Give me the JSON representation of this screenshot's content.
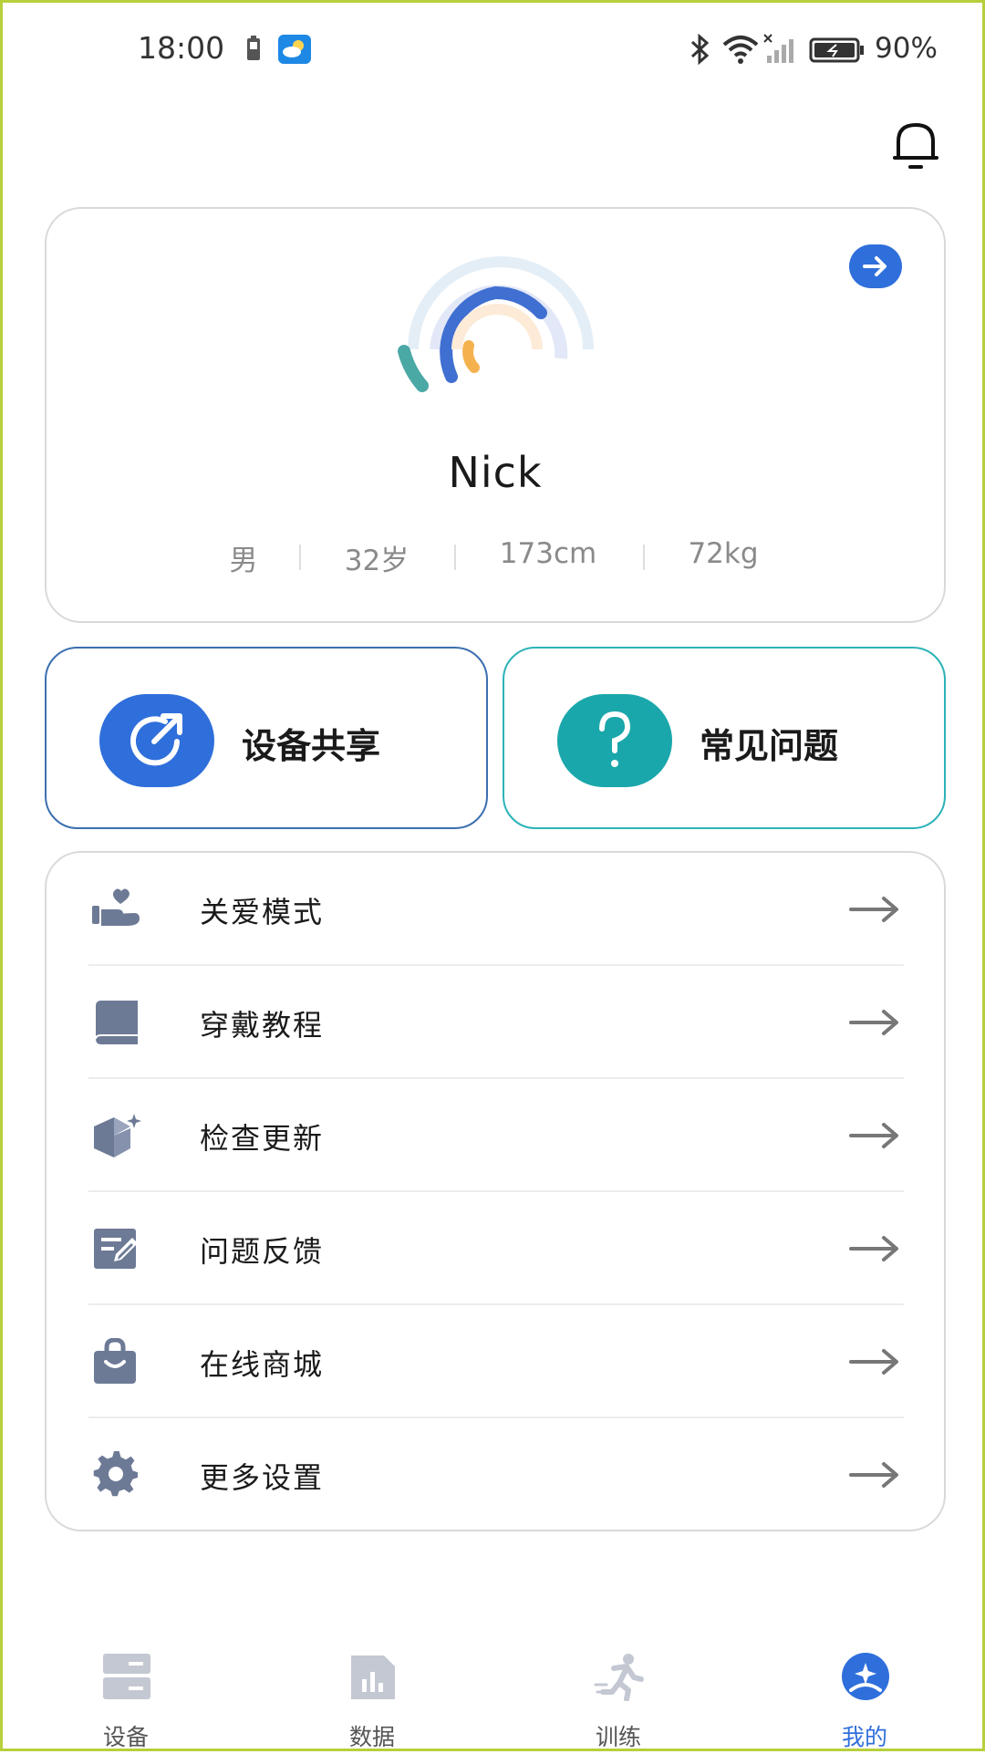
{
  "status_bar": {
    "time": "18:00",
    "battery_percent": "90%",
    "icons": [
      "battery-small-icon",
      "weather-app-icon",
      "bluetooth-icon",
      "wifi-icon",
      "signal-icon",
      "battery-icon"
    ]
  },
  "header": {
    "bell_icon": "bell-icon"
  },
  "profile": {
    "name": "Nick",
    "gender": "男",
    "age": "32岁",
    "height": "173cm",
    "weight": "72kg",
    "arrow_icon": "arrow-right-circle-icon"
  },
  "quick_actions": [
    {
      "label": "设备共享",
      "icon": "share-icon",
      "color": "#2f6fdb"
    },
    {
      "label": "常见问题",
      "icon": "question-icon",
      "color": "#1aa7ab"
    }
  ],
  "menu": [
    {
      "label": "关爱模式",
      "icon": "care-hand-heart-icon"
    },
    {
      "label": "穿戴教程",
      "icon": "book-icon"
    },
    {
      "label": "检查更新",
      "icon": "box-update-icon"
    },
    {
      "label": "问题反馈",
      "icon": "feedback-edit-icon"
    },
    {
      "label": "在线商城",
      "icon": "shopping-bag-icon"
    },
    {
      "label": "更多设置",
      "icon": "gear-icon"
    }
  ],
  "bottom_nav": [
    {
      "label": "设备",
      "icon": "device-icon",
      "active": false
    },
    {
      "label": "数据",
      "icon": "data-chart-icon",
      "active": false
    },
    {
      "label": "训练",
      "icon": "running-icon",
      "active": false
    },
    {
      "label": "我的",
      "icon": "profile-icon",
      "active": true
    }
  ],
  "colors": {
    "accent": "#2f6fdb",
    "teal": "#1aa7ab",
    "menu_icon": "#6d7a96",
    "border": "#d9d9d9"
  }
}
